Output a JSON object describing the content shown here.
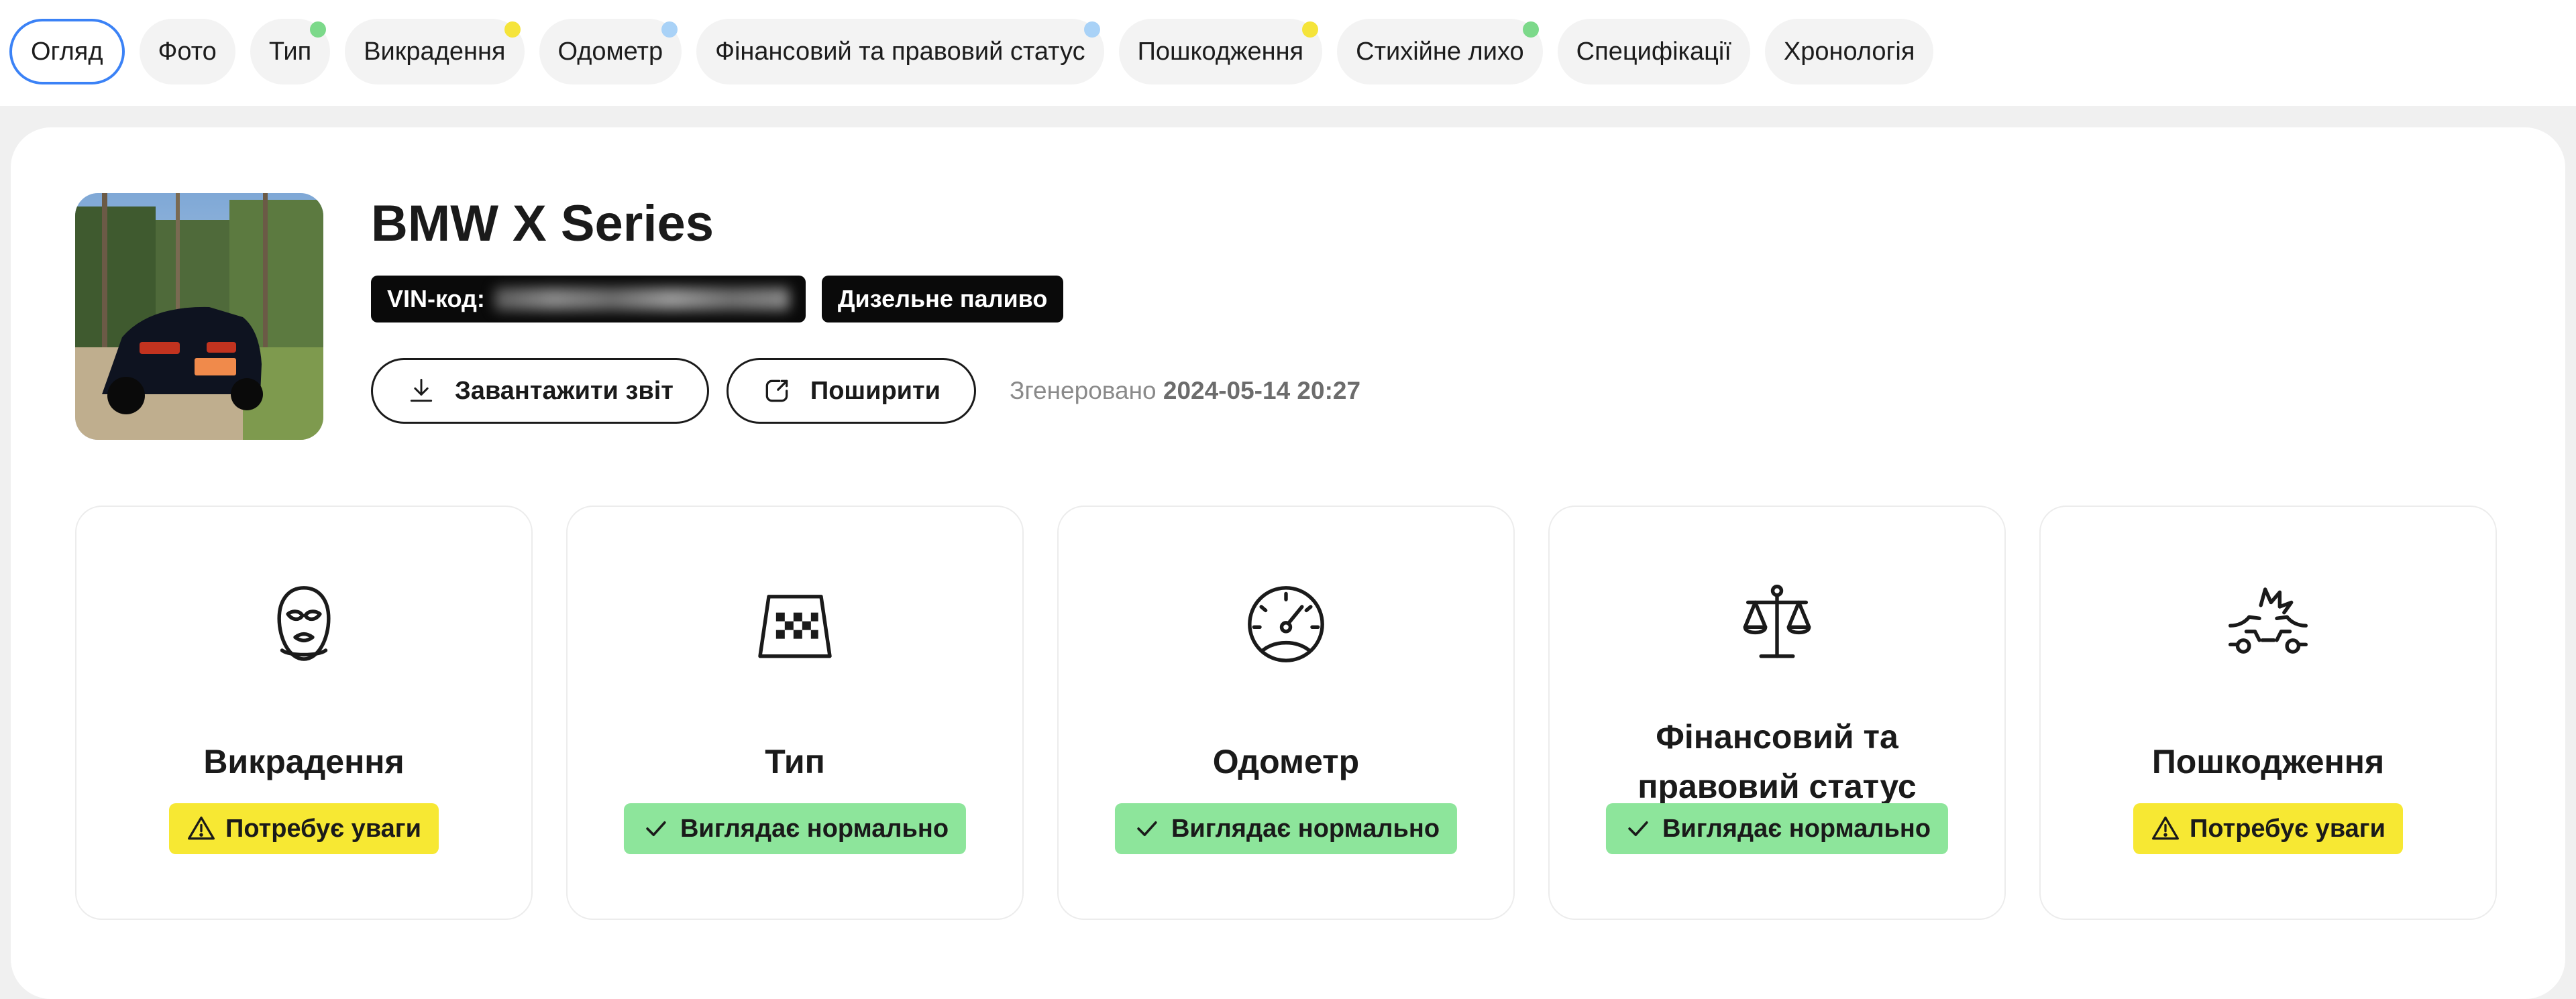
{
  "tabs": [
    {
      "label": "Огляд",
      "active": true,
      "dot": null
    },
    {
      "label": "Фото",
      "active": false,
      "dot": null
    },
    {
      "label": "Тип",
      "active": false,
      "dot": "#7cd98a"
    },
    {
      "label": "Викрадення",
      "active": false,
      "dot": "#f5e43a"
    },
    {
      "label": "Одометр",
      "active": false,
      "dot": "#a9d2f7"
    },
    {
      "label": "Фінансовий та правовий статус",
      "active": false,
      "dot": "#a9d2f7"
    },
    {
      "label": "Пошкодження",
      "active": false,
      "dot": "#f5e43a"
    },
    {
      "label": "Стихійне лихо",
      "active": false,
      "dot": "#7cd98a"
    },
    {
      "label": "Специфікації",
      "active": false,
      "dot": null
    },
    {
      "label": "Хронологія",
      "active": false,
      "dot": null
    }
  ],
  "vehicle": {
    "title": "BMW X Series",
    "vin_label": "VIN-код:",
    "fuel": "Дизельне паливо"
  },
  "actions": {
    "download_label": "Завантажити звіт",
    "share_label": "Поширити",
    "generated_label": "Згенеровано",
    "generated_at": "2024-05-14 20:27"
  },
  "tiles": [
    {
      "title": "Викрадення",
      "icon": "balaclava-icon",
      "status": "Потребує уваги",
      "level": "warn"
    },
    {
      "title": "Тип",
      "icon": "taxi-sign-icon",
      "status": "Виглядає нормально",
      "level": "ok"
    },
    {
      "title": "Одометр",
      "icon": "speedometer-icon",
      "status": "Виглядає нормально",
      "level": "ok"
    },
    {
      "title": "Фінансовий та правовий статус",
      "icon": "scales-icon",
      "status": "Виглядає нормально",
      "level": "ok"
    },
    {
      "title": "Пошкодження",
      "icon": "car-crash-icon",
      "status": "Потребує уваги",
      "level": "warn"
    }
  ],
  "colors": {
    "accent": "#3b82f6",
    "warn": "#f7e833",
    "ok": "#8de59b"
  }
}
